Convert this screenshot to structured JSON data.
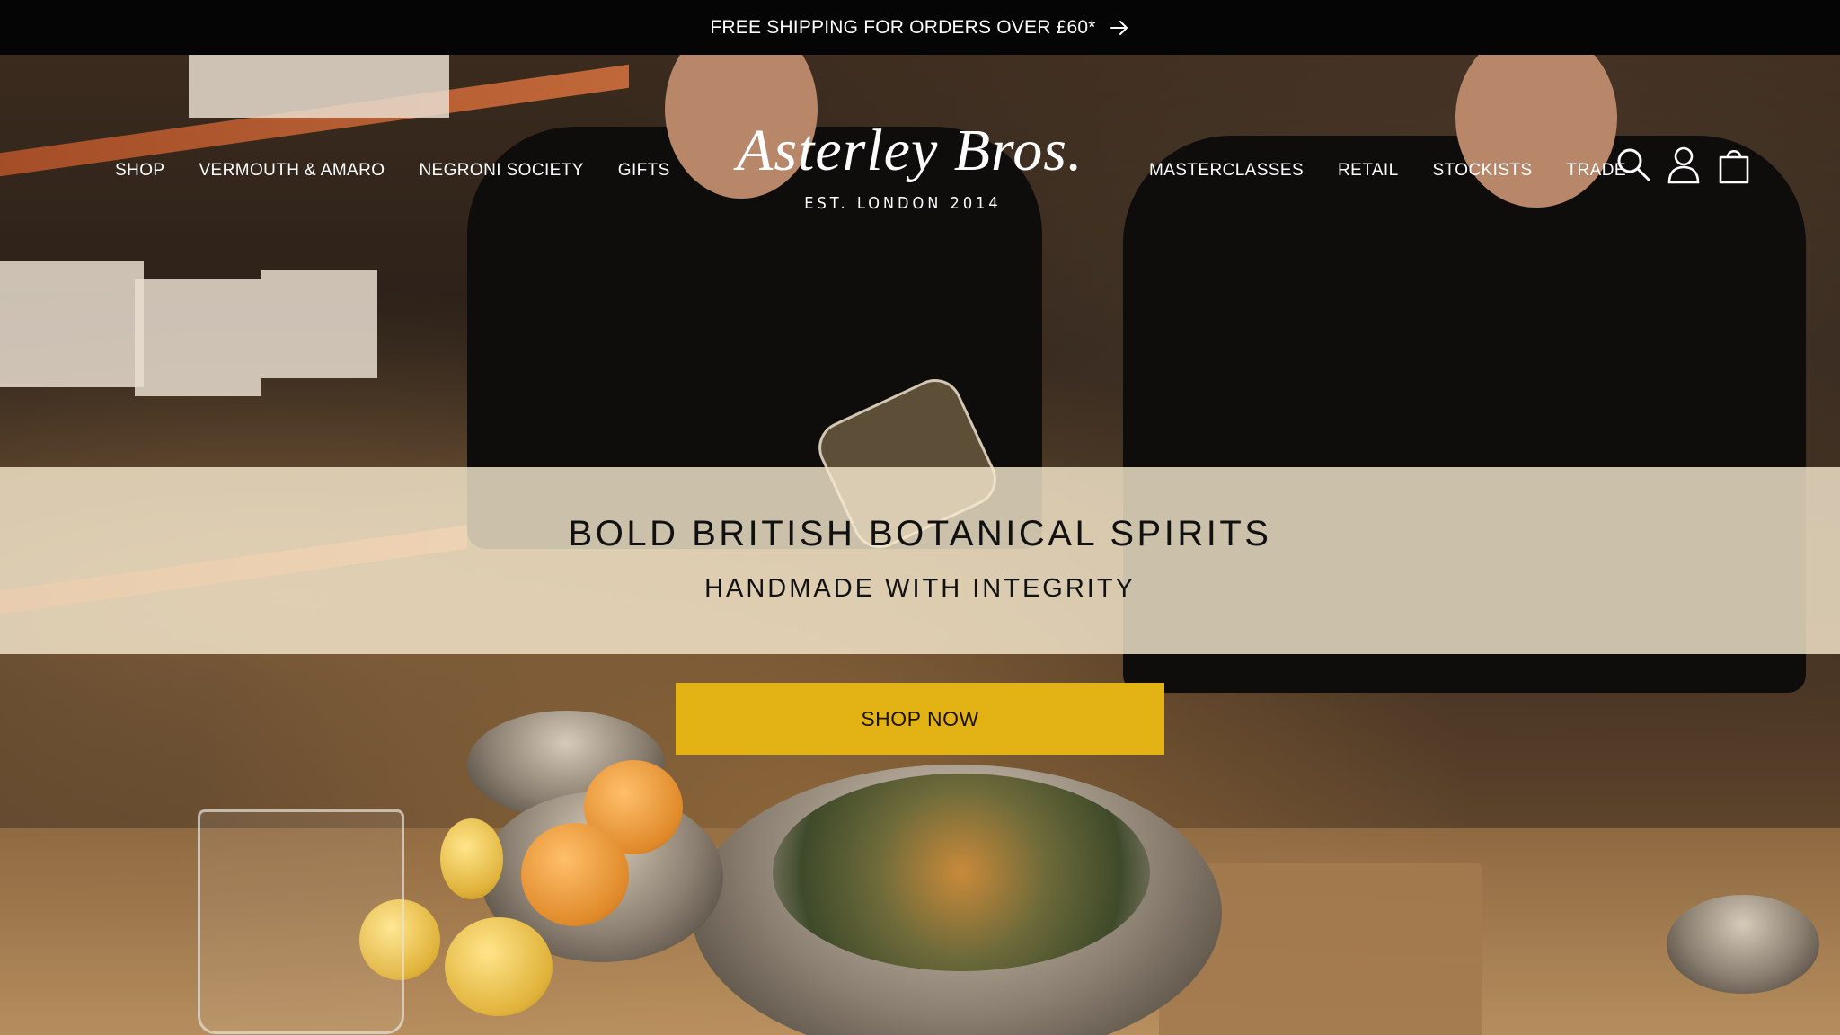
{
  "announcement": {
    "text": "FREE SHIPPING FOR ORDERS OVER £60*",
    "icon": "arrow-right-icon"
  },
  "nav_left": [
    {
      "label": "SHOP"
    },
    {
      "label": "VERMOUTH & AMARO"
    },
    {
      "label": "NEGRONI SOCIETY"
    },
    {
      "label": "GIFTS"
    }
  ],
  "logo": {
    "name": "Asterley Bros.",
    "tagline": "EST. LONDON 2014"
  },
  "nav_right": [
    {
      "label": "MASTERCLASSES"
    },
    {
      "label": "RETAIL"
    },
    {
      "label": "STOCKISTS"
    },
    {
      "label": "TRADE"
    }
  ],
  "header_icons": [
    "search-icon",
    "account-icon",
    "cart-icon"
  ],
  "hero": {
    "headline": "BOLD BRITISH BOTANICAL SPIRITS",
    "subheadline": "HANDMADE WITH INTEGRITY",
    "cta_label": "SHOP NOW",
    "cta_color": "#E3B315",
    "banner_color": "#F5E8CD"
  }
}
